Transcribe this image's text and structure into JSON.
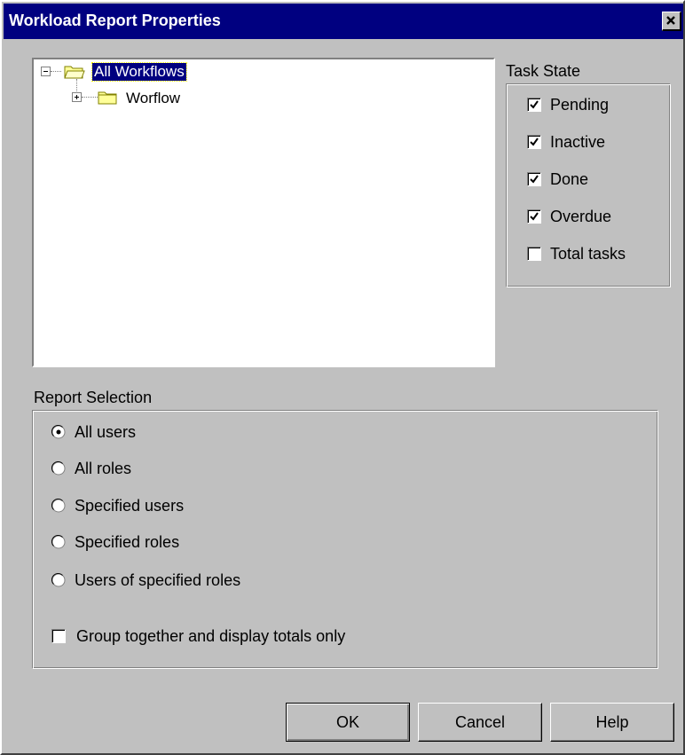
{
  "window": {
    "title": "Workload Report Properties",
    "close_glyph": "✕"
  },
  "tree": {
    "root": {
      "label": "All Workflows",
      "expanded": true,
      "selected": true,
      "icon": "folder-open-icon"
    },
    "children": [
      {
        "label": "Worflow",
        "expanded": false,
        "icon": "folder-icon"
      }
    ]
  },
  "task_state": {
    "label": "Task State",
    "options": [
      {
        "label": "Pending",
        "checked": true
      },
      {
        "label": "Inactive",
        "checked": true
      },
      {
        "label": "Done",
        "checked": true
      },
      {
        "label": "Overdue",
        "checked": true
      },
      {
        "label": "Total tasks",
        "checked": false
      }
    ]
  },
  "report_selection": {
    "label": "Report Selection",
    "options": [
      {
        "label": "All users",
        "selected": true
      },
      {
        "label": "All roles",
        "selected": false
      },
      {
        "label": "Specified users",
        "selected": false
      },
      {
        "label": "Specified roles",
        "selected": false
      },
      {
        "label": "Users of specified roles",
        "selected": false
      }
    ],
    "group_totals": {
      "label": "Group together and display totals only",
      "checked": false
    }
  },
  "buttons": {
    "ok": "OK",
    "cancel": "Cancel",
    "help": "Help"
  },
  "colors": {
    "titlebar": "#000080",
    "face": "#c0c0c0",
    "selection": "#000080"
  }
}
